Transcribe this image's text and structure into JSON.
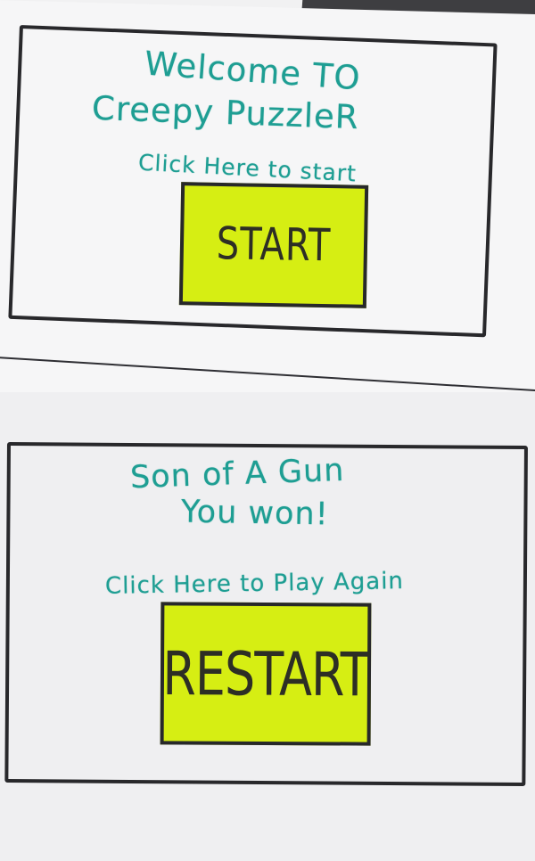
{
  "screens": {
    "welcome": {
      "line1": "Welcome TO",
      "line2": "Creepy PuzzleR",
      "instruction": "Click Here to start",
      "button_label": "START"
    },
    "win": {
      "line1": "Son of A Gun",
      "line2": "You won!",
      "instruction": "Click Here to Play Again",
      "button_label": "RESTART"
    }
  },
  "colors": {
    "marker_text": "#1e9e93",
    "button_fill": "#d6ee13",
    "outline": "#28282b",
    "paper": "#f3f3f4"
  }
}
